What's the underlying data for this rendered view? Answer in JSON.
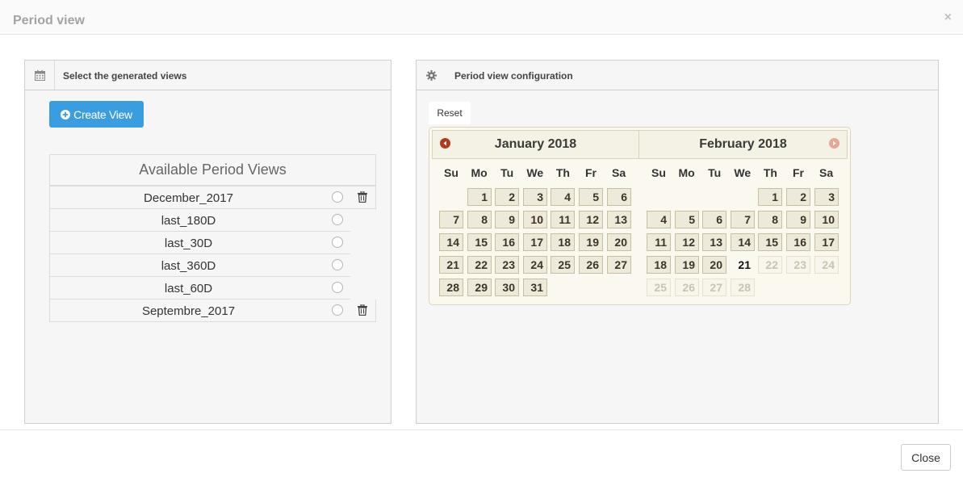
{
  "modal": {
    "title": "Period view",
    "close_symbol": "×"
  },
  "left_panel": {
    "title": "Select the generated views",
    "icon": "calendar-icon",
    "create_button": "Create View",
    "table_header": "Available Period Views",
    "views": [
      {
        "name": "December_2017",
        "deletable": true
      },
      {
        "name": "last_180D",
        "deletable": false
      },
      {
        "name": "last_30D",
        "deletable": false
      },
      {
        "name": "last_360D",
        "deletable": false
      },
      {
        "name": "last_60D",
        "deletable": false
      },
      {
        "name": "Septembre_2017",
        "deletable": true
      }
    ]
  },
  "right_panel": {
    "title": "Period view configuration",
    "icon": "gear-icon",
    "reset_label": "Reset",
    "calendar": {
      "weekdays": [
        "Su",
        "Mo",
        "Tu",
        "We",
        "Th",
        "Fr",
        "Sa"
      ],
      "months": [
        {
          "label": "January 2018",
          "first_weekday": 1,
          "days": 31,
          "disabled_from": null,
          "today": null
        },
        {
          "label": "February 2018",
          "first_weekday": 4,
          "days": 28,
          "disabled_from": 22,
          "today": 21
        }
      ]
    }
  },
  "footer": {
    "close_label": "Close"
  },
  "colors": {
    "primary_button": "#3a9de0",
    "prev_arrow": "#b2391e",
    "next_arrow": "#e5a895"
  }
}
